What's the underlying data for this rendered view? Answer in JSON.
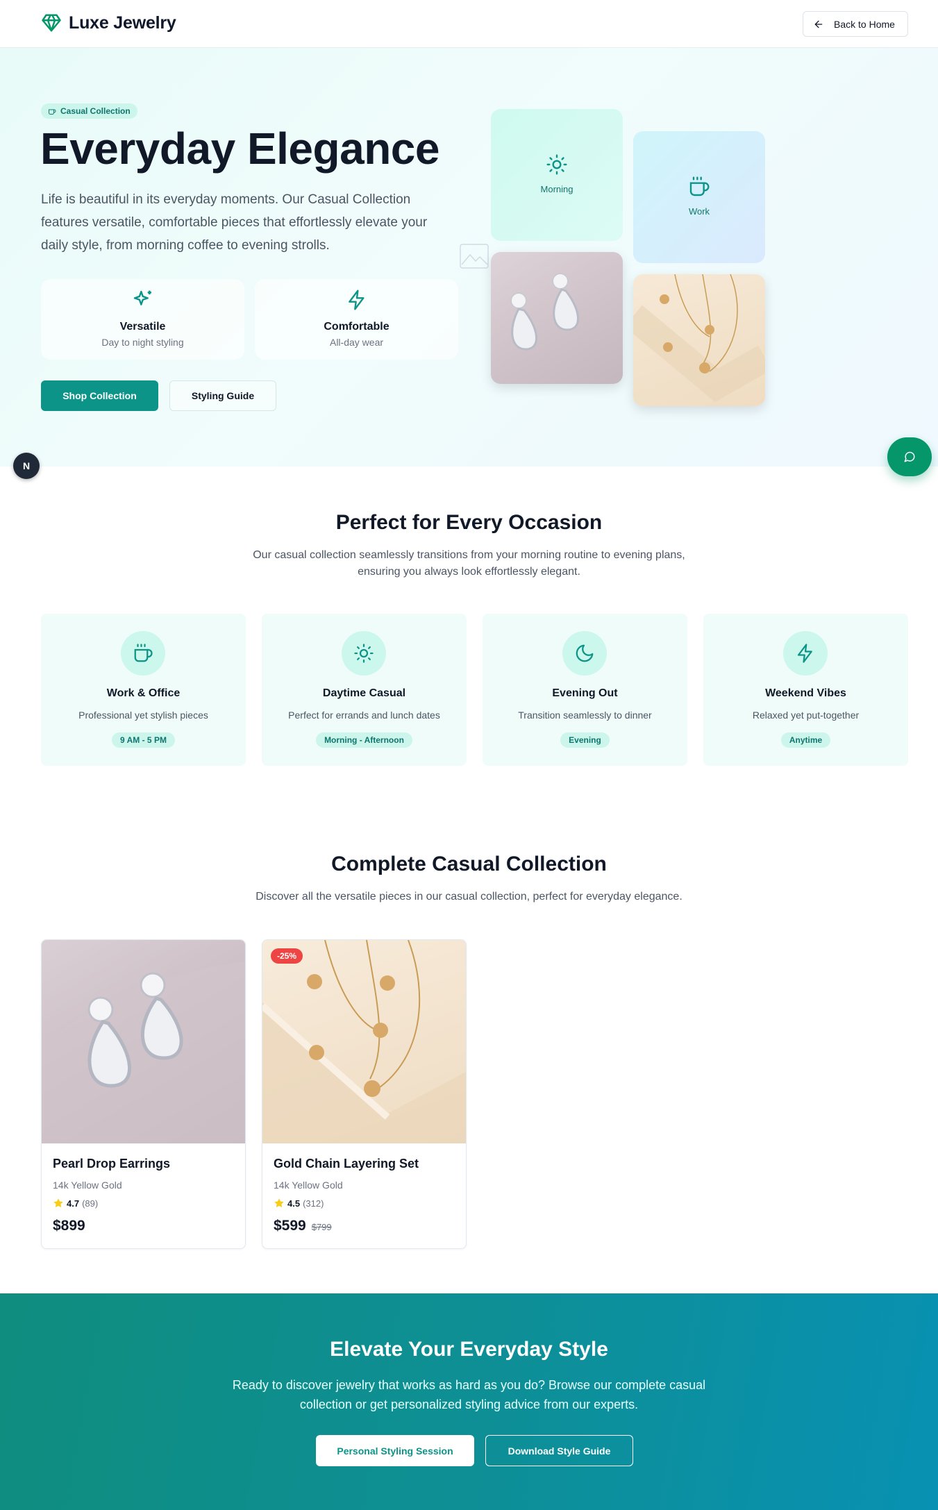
{
  "header": {
    "brand": "Luxe Jewelry",
    "back_label": "Back to Home"
  },
  "hero": {
    "badge": "Casual Collection",
    "title": "Everyday Elegance",
    "description": "Life is beautiful in its everyday moments. Our Casual Collection features versatile, comfortable pieces that effortlessly elevate your daily style, from morning coffee to evening strolls.",
    "features": [
      {
        "title": "Versatile",
        "subtitle": "Day to night styling",
        "icon": "sparkles-icon"
      },
      {
        "title": "Comfortable",
        "subtitle": "All-day wear",
        "icon": "zap-icon"
      }
    ],
    "primary_button": "Shop Collection",
    "secondary_button": "Styling Guide",
    "tiles": [
      {
        "label": "Morning",
        "icon": "sun-icon"
      },
      {
        "label": "Work",
        "icon": "coffee-icon"
      }
    ]
  },
  "occasions": {
    "title": "Perfect for Every Occasion",
    "subtitle": "Our casual collection seamlessly transitions from your morning routine to evening plans, ensuring you always look effortlessly elegant.",
    "items": [
      {
        "title": "Work & Office",
        "description": "Professional yet stylish pieces",
        "tag": "9 AM - 5 PM",
        "icon": "coffee-icon"
      },
      {
        "title": "Daytime Casual",
        "description": "Perfect for errands and lunch dates",
        "tag": "Morning - Afternoon",
        "icon": "sun-icon"
      },
      {
        "title": "Evening Out",
        "description": "Transition seamlessly to dinner",
        "tag": "Evening",
        "icon": "moon-icon"
      },
      {
        "title": "Weekend Vibes",
        "description": "Relaxed yet put-together",
        "tag": "Anytime",
        "icon": "zap-icon"
      }
    ]
  },
  "collection": {
    "title": "Complete Casual Collection",
    "subtitle": "Discover all the versatile pieces in our casual collection, perfect for everyday elegance.",
    "products": [
      {
        "name": "Pearl Drop Earrings",
        "material": "14k Yellow Gold",
        "rating": "4.7",
        "reviews": "(89)",
        "price": "$899",
        "old_price": "",
        "badge": ""
      },
      {
        "name": "Gold Chain Layering Set",
        "material": "14k Yellow Gold",
        "rating": "4.5",
        "reviews": "(312)",
        "price": "$599",
        "old_price": "$799",
        "badge": "-25%"
      }
    ]
  },
  "cta": {
    "title": "Elevate Your Everyday Style",
    "description": "Ready to discover jewelry that works as hard as you do? Browse our complete casual collection or get personalized styling advice from our experts.",
    "button_primary": "Personal Styling Session",
    "button_secondary": "Download Style Guide"
  },
  "floating": {
    "dev_badge": "N"
  },
  "colors": {
    "accent": "#0d9488",
    "accent_light": "#ccf5ec",
    "sale": "#ef4444",
    "star": "#facc15"
  }
}
